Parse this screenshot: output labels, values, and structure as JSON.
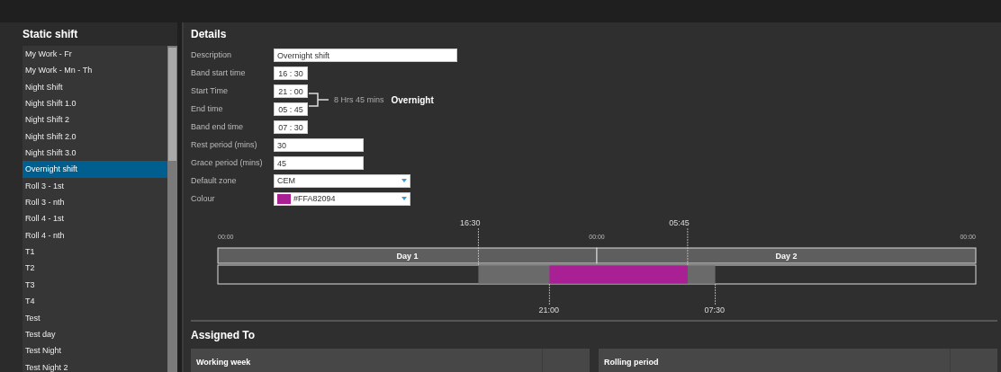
{
  "sidebar": {
    "title": "Static shift",
    "items": [
      {
        "label": "My Work - Fr",
        "selected": false
      },
      {
        "label": "My Work - Mn - Th",
        "selected": false
      },
      {
        "label": "Night Shift",
        "selected": false
      },
      {
        "label": "Night Shift 1.0",
        "selected": false
      },
      {
        "label": "Night Shift 2",
        "selected": false
      },
      {
        "label": "Night Shift 2.0",
        "selected": false
      },
      {
        "label": "Night Shift 3.0",
        "selected": false
      },
      {
        "label": "Overnight shift",
        "selected": true
      },
      {
        "label": "Roll 3 - 1st",
        "selected": false
      },
      {
        "label": "Roll 3 - nth",
        "selected": false
      },
      {
        "label": "Roll 4 - 1st",
        "selected": false
      },
      {
        "label": "Roll 4 - nth",
        "selected": false
      },
      {
        "label": "T1",
        "selected": false
      },
      {
        "label": "T2",
        "selected": false
      },
      {
        "label": "T3",
        "selected": false
      },
      {
        "label": "T4",
        "selected": false
      },
      {
        "label": "Test",
        "selected": false
      },
      {
        "label": "Test day",
        "selected": false
      },
      {
        "label": "Test Night",
        "selected": false
      },
      {
        "label": "Test Night 2",
        "selected": false
      }
    ]
  },
  "details": {
    "title": "Details",
    "fields": [
      {
        "kind": "text",
        "label": "Description",
        "value": "Overnight shift"
      },
      {
        "kind": "time",
        "label": "Band start time",
        "value": "16 : 30"
      },
      {
        "kind": "time",
        "label": "Start Time",
        "value": "21 : 00"
      },
      {
        "kind": "time",
        "label": "End time",
        "value": "05 : 45"
      },
      {
        "kind": "time",
        "label": "Band end time",
        "value": "07 : 30"
      },
      {
        "kind": "number",
        "label": "Rest period (mins)",
        "value": "30"
      },
      {
        "kind": "number",
        "label": "Grace period (mins)",
        "value": "45"
      },
      {
        "kind": "select",
        "label": "Default zone",
        "value": "CEM"
      },
      {
        "kind": "color",
        "label": "Colour",
        "value": "#FFA82094",
        "color": "#a82094"
      }
    ],
    "duration": "8 Hrs 45 mins",
    "duration_type": "Overnight"
  },
  "timeline": {
    "axis_ticks": [
      "00:00",
      "00:00",
      "00:00"
    ],
    "days": [
      "Day 1",
      "Day 2"
    ],
    "markers": [
      {
        "label": "16:30",
        "kind": "top"
      },
      {
        "label": "21:00",
        "kind": "bottom"
      },
      {
        "label": "05:45",
        "kind": "top"
      },
      {
        "label": "07:30",
        "kind": "bottom"
      }
    ]
  },
  "assigned": {
    "title": "Assigned To",
    "tables": [
      {
        "heading": "Working week"
      },
      {
        "heading": "Rolling period"
      }
    ]
  }
}
